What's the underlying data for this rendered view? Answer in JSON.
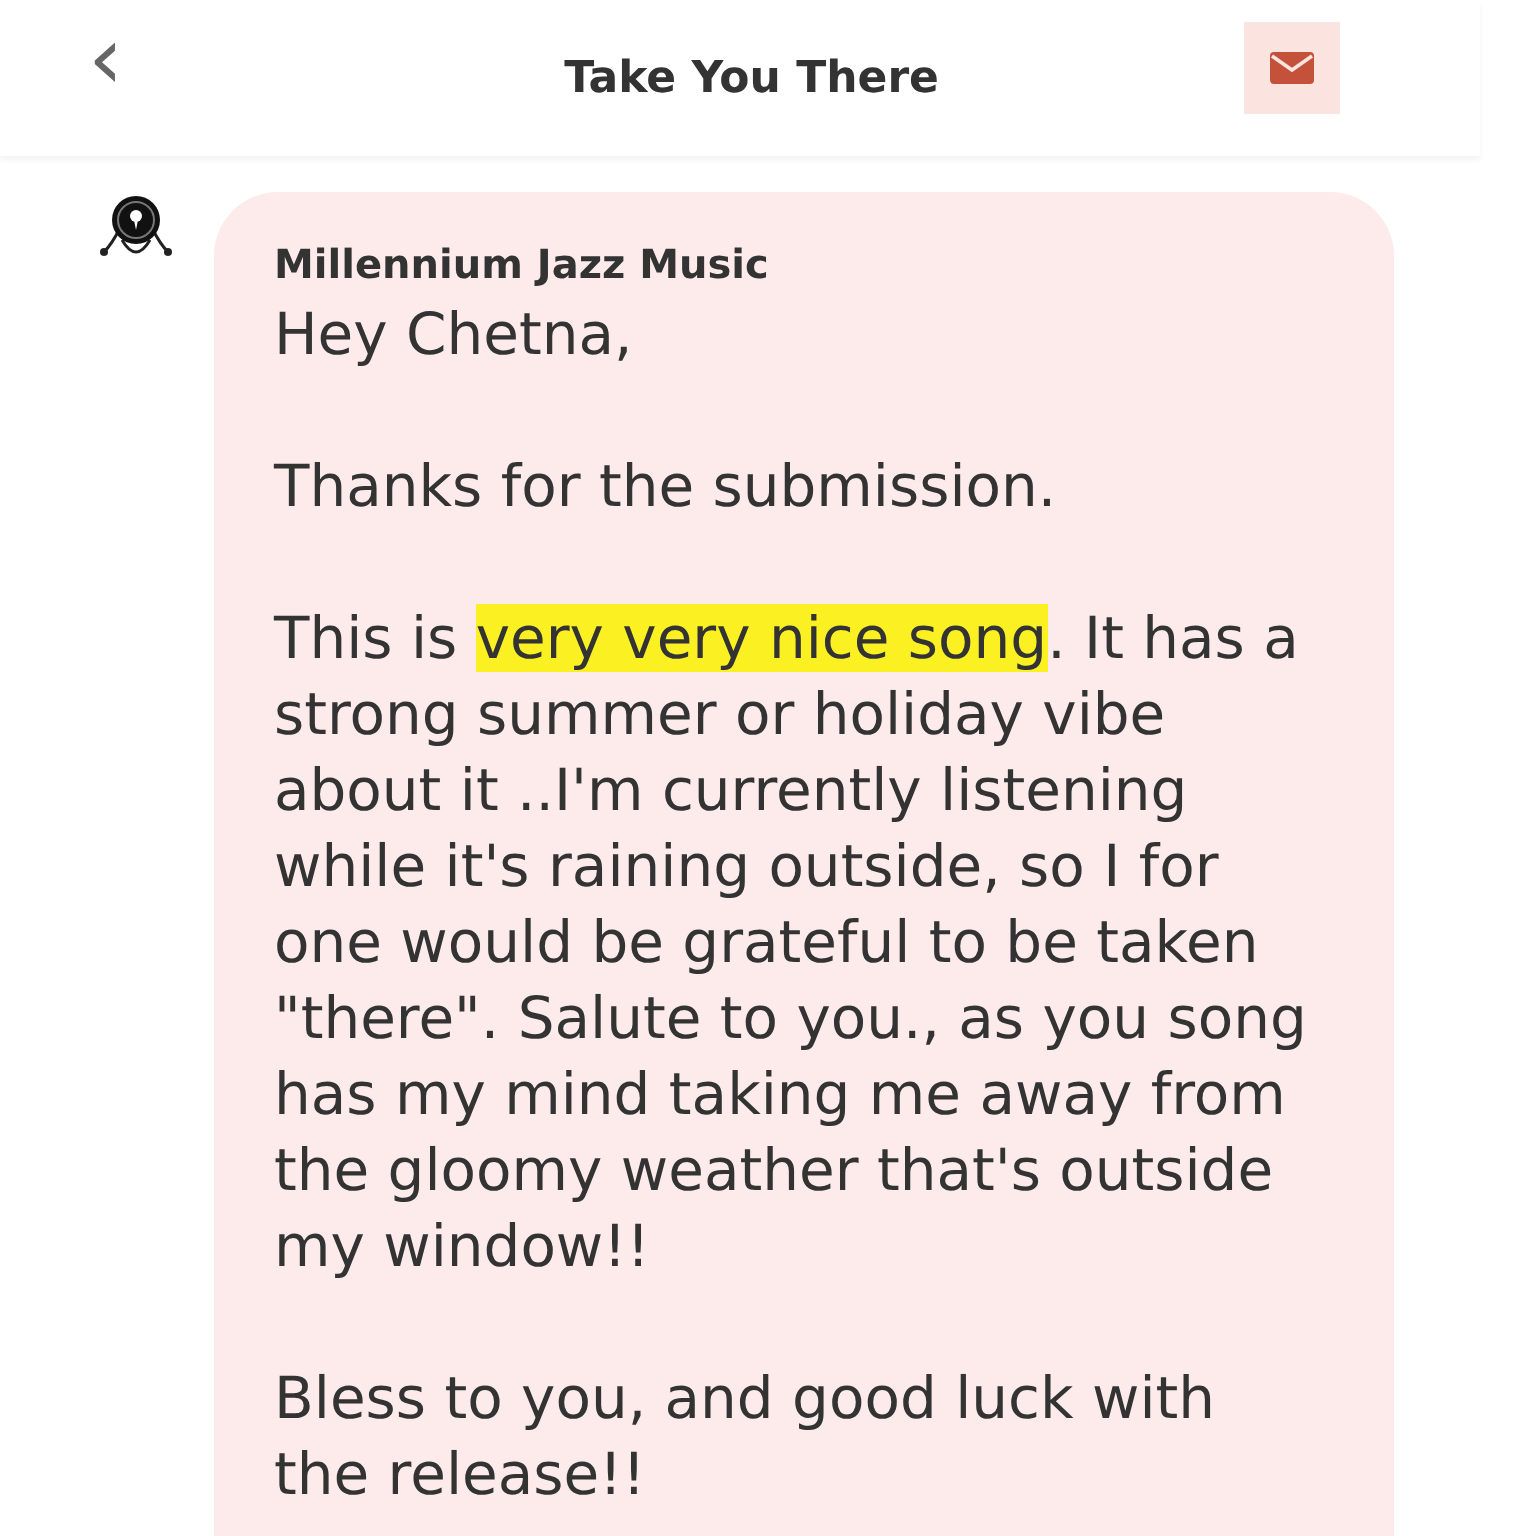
{
  "header": {
    "back_icon": "‹",
    "title": "Take You There"
  },
  "message": {
    "sender": "Millennium Jazz Music",
    "paragraphs": [
      [
        {
          "text": "Hey Chetna,",
          "highlighted": false
        }
      ],
      [
        {
          "text": "Thanks for the submission.",
          "highlighted": false
        }
      ],
      [
        {
          "text": "This is ",
          "highlighted": false
        },
        {
          "text": "very very nice song",
          "highlighted": true
        },
        {
          "text": ". It has a strong summer or holiday vibe about it ..I'm currently listening while it's raining outside, so I for one would be grateful to be taken \"there\". Salute to you., as you song has my mind taking me away from the gloomy weather that's outside my window!!",
          "highlighted": false
        }
      ],
      [
        {
          "text": "Bless to you, and good luck with the release!!",
          "highlighted": false
        }
      ]
    ]
  }
}
